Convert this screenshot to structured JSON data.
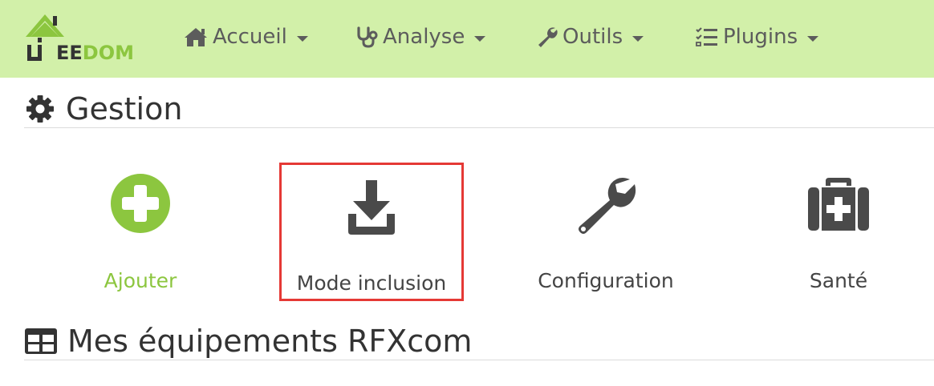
{
  "navbar": {
    "logo": {
      "text_part1": "EE",
      "text_part2": "DOM",
      "icon": "jeedom-house-logo"
    },
    "items": [
      {
        "label": "Accueil",
        "icon": "home-icon"
      },
      {
        "label": "Analyse",
        "icon": "stethoscope-icon"
      },
      {
        "label": "Outils",
        "icon": "wrench-icon"
      },
      {
        "label": "Plugins",
        "icon": "tasks-list-icon"
      }
    ]
  },
  "gestion": {
    "title": "Gestion",
    "icon": "cog-icon",
    "cards": [
      {
        "label": "Ajouter",
        "icon": "plus-circle-icon",
        "color": "#8cc63f"
      },
      {
        "label": "Mode inclusion",
        "icon": "download-icon",
        "highlighted": true,
        "highlight_color": "#e53935"
      },
      {
        "label": "Configuration",
        "icon": "wrench-icon"
      },
      {
        "label": "Santé",
        "icon": "medkit-icon"
      }
    ]
  },
  "equipements": {
    "title": "Mes équipements RFXcom",
    "icon": "table-icon"
  },
  "colors": {
    "navbar_bg": "#d2f0a9",
    "accent_green": "#8cc63f",
    "text_dark": "#333333",
    "icon_gray": "#4a4a4a",
    "highlight_red": "#e53935"
  }
}
